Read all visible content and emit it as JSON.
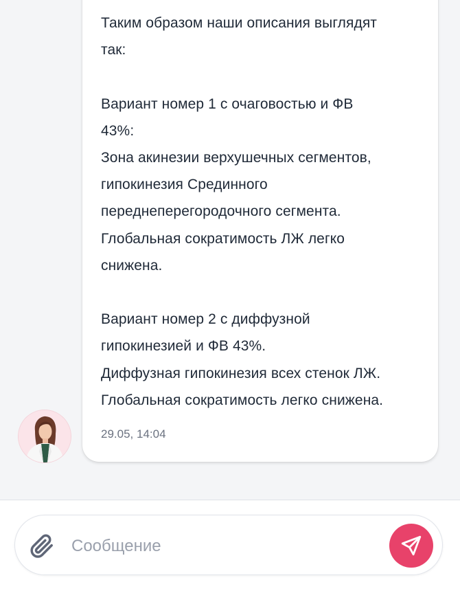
{
  "message": {
    "lines_block1": "Таким образом наши описания выглядят\nтак:",
    "lines_block2": "Вариант номер 1 с очаговостью и ФВ\n43%:\nЗона акинезии верхушечных сегментов,\nгипокинезия Срединного\nпереднеперегородочного сегмента.\nГлобальная сократимость ЛЖ легко\nснижена.",
    "lines_block3": "Вариант номер 2 с диффузной\nгипокинезией и ФВ 43%.\nДиффузная гипокинезия всех стенок ЛЖ.\nГлобальная сократимость легко снижена.",
    "timestamp": "29.05, 14:04"
  },
  "sender": {
    "avatar_icon": "avatar-photo-doctor"
  },
  "composer": {
    "placeholder": "Сообщение",
    "value": "",
    "attach_icon": "paperclip-icon",
    "send_icon": "paper-plane-icon"
  },
  "colors": {
    "accent": "#e8426a",
    "text": "#1f2937",
    "muted": "#6b7280",
    "background": "#f4f5f7"
  }
}
